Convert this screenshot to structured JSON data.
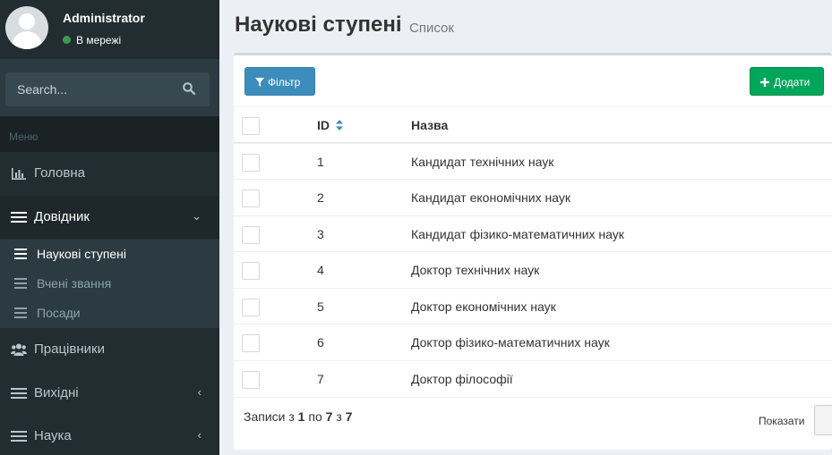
{
  "user": {
    "name": "Administrator",
    "status": "В мережі"
  },
  "search": {
    "placeholder": "Search..."
  },
  "menu": {
    "header": "Меню",
    "items": [
      {
        "label": "Головна",
        "icon": "bar-chart-icon"
      },
      {
        "label": "Довідник",
        "icon": "list-icon"
      },
      {
        "label": "Працівники",
        "icon": "users-icon"
      },
      {
        "label": "Вихідні",
        "icon": "list-icon"
      },
      {
        "label": "Наука",
        "icon": "list-icon"
      }
    ],
    "submenu": [
      {
        "label": "Наукові ступені"
      },
      {
        "label": "Вчені звання"
      },
      {
        "label": "Посади"
      }
    ]
  },
  "page": {
    "title": "Наукові ступені",
    "subtitle": "Список"
  },
  "toolbar": {
    "filter_label": "Фільтр",
    "add_label": "Додати"
  },
  "table": {
    "columns": {
      "id": "ID",
      "name": "Назва"
    },
    "rows": [
      {
        "id": "1",
        "name": "Кандидат технічних наук"
      },
      {
        "id": "2",
        "name": "Кандидат економічних наук"
      },
      {
        "id": "3",
        "name": "Кандидат фізико-математичних наук"
      },
      {
        "id": "4",
        "name": "Доктор технічних наук"
      },
      {
        "id": "5",
        "name": "Доктор економічних наук"
      },
      {
        "id": "6",
        "name": "Доктор фізико-математичних наук"
      },
      {
        "id": "7",
        "name": "Доктор філософії"
      }
    ]
  },
  "pagination": {
    "prefix": "Записи з",
    "from": "1",
    "mid": "по",
    "to": "7",
    "of": "з",
    "total": "7",
    "show_label": "Показати"
  },
  "colors": {
    "sidebar": "#222d32",
    "primary": "#3c8dbc",
    "success": "#00a65a",
    "status_online": "#3c9a4b"
  }
}
